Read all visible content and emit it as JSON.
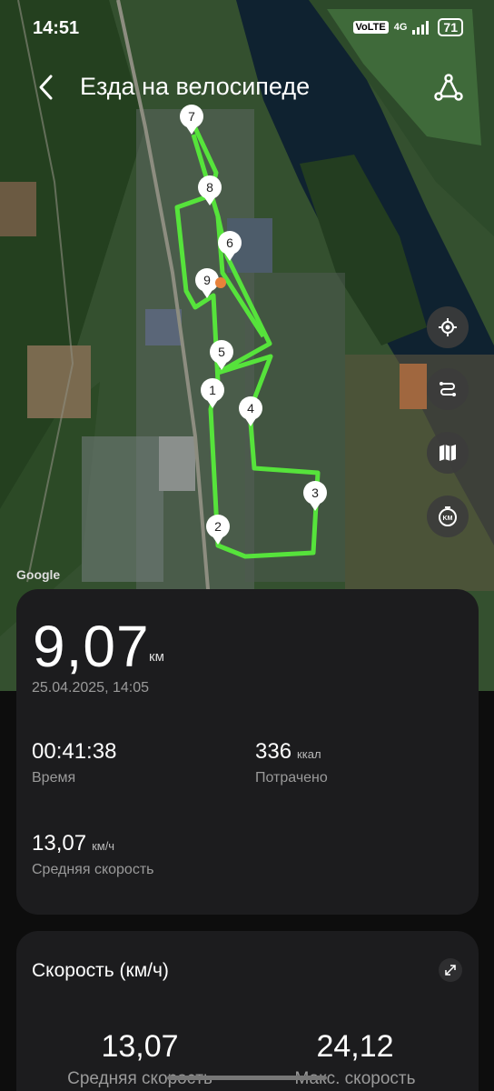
{
  "status_bar": {
    "time": "14:51",
    "volte": "VoLTE",
    "network": "4G",
    "battery": "71"
  },
  "header": {
    "title": "Езда на велосипеде"
  },
  "map": {
    "attribution": "Google",
    "markers": [
      "1",
      "2",
      "3",
      "4",
      "5",
      "6",
      "7",
      "8",
      "9"
    ],
    "route_color": "#56e33b"
  },
  "summary": {
    "distance_value": "9,07",
    "distance_unit": "км",
    "datetime": "25.04.2025, 14:05",
    "duration_value": "00:41:38",
    "duration_label": "Время",
    "calories_value": "336",
    "calories_unit": "ккал",
    "calories_label": "Потрачено",
    "avg_speed_value": "13,07",
    "avg_speed_unit": "км/ч",
    "avg_speed_label": "Средняя скорость"
  },
  "speed_card": {
    "title": "Скорость (км/ч)",
    "avg_value": "13,07",
    "avg_label": "Средняя скорость",
    "max_value": "24,12",
    "max_label": "Макс. скорость"
  }
}
